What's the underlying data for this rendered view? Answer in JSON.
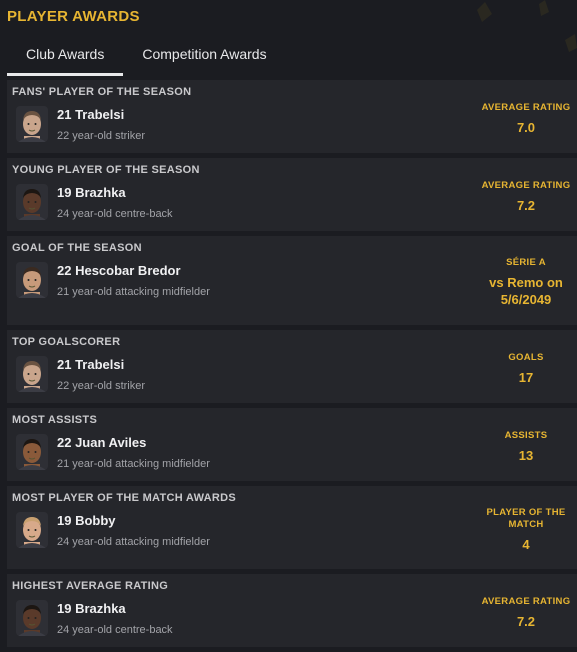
{
  "page": {
    "title": "PLAYER AWARDS"
  },
  "tabs": [
    {
      "label": "Club Awards",
      "active": true
    },
    {
      "label": "Competition Awards",
      "active": false
    }
  ],
  "awards": [
    {
      "title": "FANS' PLAYER OF THE SEASON",
      "player": "21 Trabelsi",
      "desc": "22 year-old striker",
      "stat_label": "AVERAGE RATING",
      "stat_value": "7.0",
      "skin": "#c9a58c",
      "hair": "#6a5342"
    },
    {
      "title": "YOUNG PLAYER OF THE SEASON",
      "player": "19 Brazhka",
      "desc": "24 year-old centre-back",
      "stat_label": "AVERAGE RATING",
      "stat_value": "7.2",
      "skin": "#5a3a2a",
      "hair": "#1c1612"
    },
    {
      "title": "GOAL OF THE SEASON",
      "player": "22 Hescobar Bredor",
      "desc": "21 year-old attacking midfielder",
      "stat_label": "SÉRIE A",
      "stat_value": "vs Remo on 5/6/2049",
      "skin": "#c79a7a",
      "hair": "#3a2a20"
    },
    {
      "title": "TOP GOALSCORER",
      "player": "21 Trabelsi",
      "desc": "22 year-old striker",
      "stat_label": "GOALS",
      "stat_value": "17",
      "skin": "#c9a58c",
      "hair": "#6a5342"
    },
    {
      "title": "MOST ASSISTS",
      "player": "22 Juan Aviles",
      "desc": "21 year-old attacking midfielder",
      "stat_label": "ASSISTS",
      "stat_value": "13",
      "skin": "#8a5a3a",
      "hair": "#1c1612"
    },
    {
      "title": "MOST PLAYER OF THE MATCH AWARDS",
      "player": "19 Bobby",
      "desc": "24 year-old attacking midfielder",
      "stat_label": "PLAYER OF THE MATCH",
      "stat_value": "4",
      "skin": "#d7a98a",
      "hair": "#c8a070"
    },
    {
      "title": "HIGHEST AVERAGE RATING",
      "player": "19 Brazhka",
      "desc": "24 year-old centre-back",
      "stat_label": "AVERAGE RATING",
      "stat_value": "7.2",
      "skin": "#5a3a2a",
      "hair": "#1c1612"
    }
  ],
  "colors": {
    "accent": "#e7b532",
    "card": "#25262b",
    "background": "#1b1c21"
  }
}
